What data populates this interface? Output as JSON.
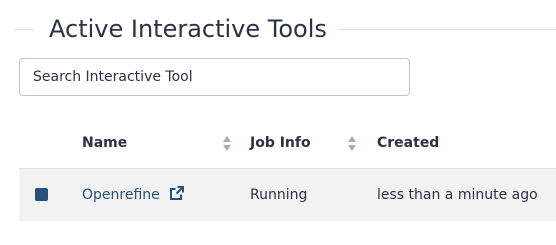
{
  "page": {
    "title": "Active Interactive Tools"
  },
  "search": {
    "placeholder": "Search Interactive Tool"
  },
  "table": {
    "columns": [
      {
        "label": "Name",
        "sortable": true
      },
      {
        "label": "Job Info",
        "sortable": true
      },
      {
        "label": "Created",
        "sortable": false
      }
    ],
    "rows": [
      {
        "name": "Openrefine",
        "job_info": "Running",
        "created": "less than a minute ago",
        "selected": true
      }
    ]
  },
  "icons": {
    "sort": "sort-icon",
    "external_link": "external-link-icon",
    "checkbox": "checkbox-icon"
  },
  "colors": {
    "text": "#2c3143",
    "link": "#25537b",
    "row_background": "#f2f2f2",
    "border": "#dee2e6",
    "sort_icon": "#a6acb3"
  }
}
